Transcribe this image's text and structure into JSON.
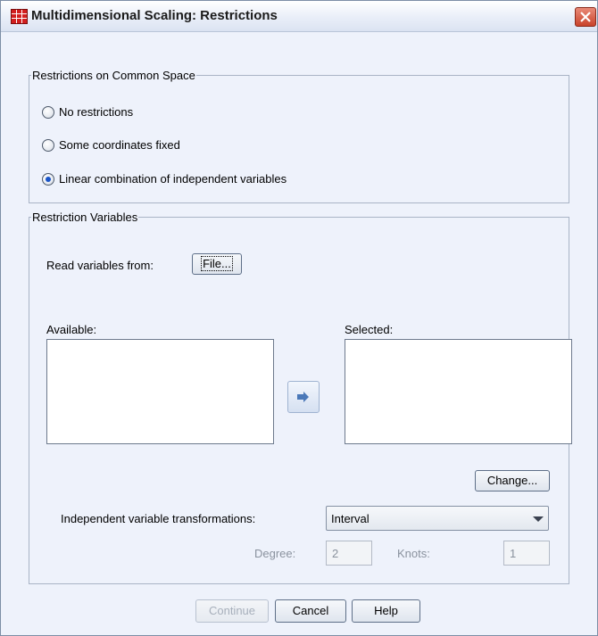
{
  "window": {
    "title": "Multidimensional Scaling: Restrictions"
  },
  "common_space": {
    "title": "Restrictions on Common Space",
    "options": [
      {
        "label": "No restrictions",
        "checked": false
      },
      {
        "label": "Some coordinates fixed",
        "checked": false
      },
      {
        "label": "Linear combination of independent variables",
        "checked": true
      }
    ]
  },
  "restriction_vars": {
    "title": "Restriction Variables",
    "read_from_label": "Read variables from:",
    "file_button": "File...",
    "available_label": "Available:",
    "selected_label": "Selected:",
    "change_button": "Change...",
    "transform_label": "Independent variable transformations:",
    "transform_value": "Interval",
    "degree_label": "Degree:",
    "degree_value": "2",
    "knots_label": "Knots:",
    "knots_value": "1"
  },
  "footer": {
    "continue": "Continue",
    "cancel": "Cancel",
    "help": "Help"
  }
}
